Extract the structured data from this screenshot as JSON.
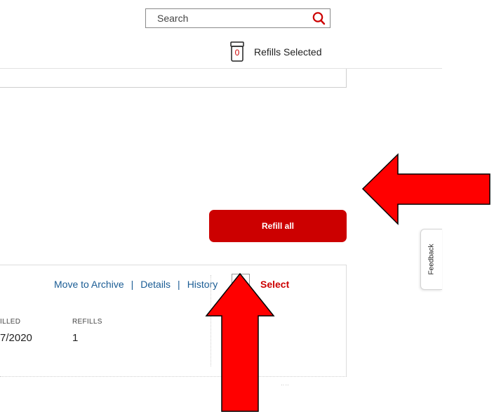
{
  "search": {
    "placeholder": "Search"
  },
  "refills": {
    "count": "0",
    "label": "Refills Selected"
  },
  "top_card": {
    "fragment": ""
  },
  "refill_all": {
    "label": "Refill all"
  },
  "feedback": {
    "label": "Feedback"
  },
  "rx_card": {
    "links": [
      "Move to Archive",
      "Details",
      "History"
    ],
    "separator": "|",
    "select_label": "Select",
    "columns": {
      "filled_label": "ILLED",
      "filled_value": "7/2020",
      "refills_label": "REFILLS",
      "refills_value": "1"
    }
  },
  "colors": {
    "accent": "#cc0000",
    "link": "#1a5c94",
    "arrow": "#ff0000"
  }
}
